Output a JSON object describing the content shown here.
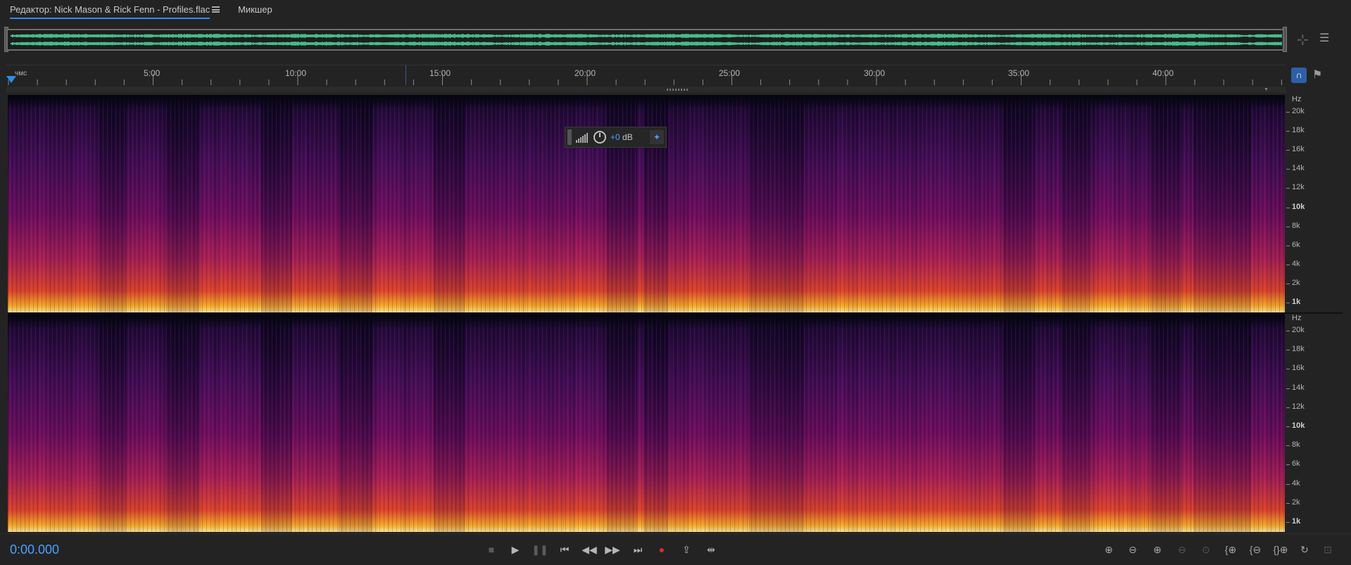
{
  "tabs": {
    "editor_label": "Редактор: Nick Mason & Rick Fenn - Profiles.flac",
    "mixer_label": "Микшер"
  },
  "ruler": {
    "unit_label": "чмс",
    "time_labels": [
      "5:00",
      "10:00",
      "15:00",
      "20:00",
      "25:00",
      "30:00",
      "35:00",
      "40:00"
    ]
  },
  "frequency_axis": {
    "unit": "Hz",
    "labels": [
      "20k",
      "18k",
      "16k",
      "14k",
      "12k",
      "10k",
      "8k",
      "6k",
      "4k",
      "2k",
      "1k"
    ],
    "bold_labels": [
      "10k",
      "1k"
    ]
  },
  "hud": {
    "gain_value": "+0",
    "gain_unit": "dB"
  },
  "transport": {
    "current_time": "0:00.000",
    "buttons": [
      "stop-icon",
      "play-icon",
      "pause-icon",
      "skip-back-icon",
      "rewind-icon",
      "fast-forward-icon",
      "skip-forward-icon",
      "record-icon",
      "loop-icon",
      "skip-selection-icon"
    ]
  },
  "zoom_buttons": [
    "zoom-in-amplitude-icon",
    "zoom-out-amplitude-icon",
    "zoom-in-time-icon",
    "zoom-out-time-icon",
    "zoom-full-icon",
    "zoom-in-selection-icon",
    "zoom-out-full-icon",
    "zoom-in-left-icon",
    "zoom-in-right-icon",
    "zoom-reset-icon",
    "zoom-settings-icon"
  ],
  "colors": {
    "accent": "#2d8ceb",
    "waveform": "#50e3a8",
    "record": "#e02a2a"
  }
}
